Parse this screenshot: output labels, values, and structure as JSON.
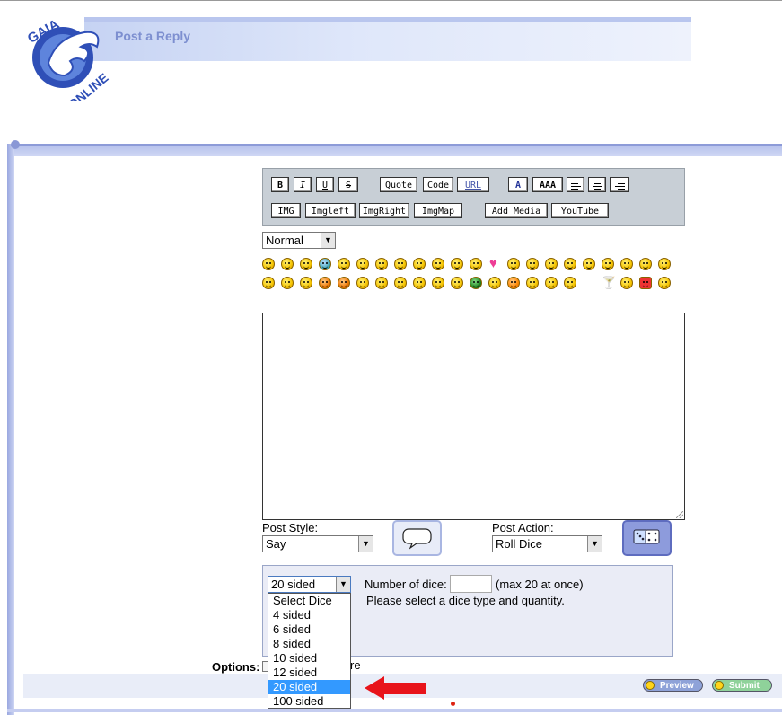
{
  "header": {
    "title": "Post a Reply",
    "logo_top": "GAIA",
    "logo_bottom": "ONLINE"
  },
  "toolbar": {
    "row1": [
      "B",
      "I",
      "U",
      "S",
      "Quote",
      "Code",
      "URL",
      "A",
      "AAA"
    ],
    "row2": [
      "IMG",
      "Imgleft",
      "ImgRight",
      "ImgMap",
      "Add Media",
      "YouTube"
    ]
  },
  "size_select": {
    "value": "Normal"
  },
  "post_style": {
    "label": "Post Style:",
    "value": "Say"
  },
  "post_action": {
    "label": "Post Action:",
    "value": "Roll Dice"
  },
  "dice": {
    "selected": "20 sided",
    "count_label": "Number of dice:",
    "max_note": "(max 20 at once)",
    "hint": "Please select a dice type and quantity.",
    "options": [
      "Select Dice",
      "4 sided",
      "6 sided",
      "8 sided",
      "10 sided",
      "12 sided",
      "20 sided",
      "100 sided"
    ],
    "highlighted_index": 6
  },
  "options": {
    "label": "Options:",
    "partial_text": "re"
  },
  "buttons": {
    "preview": "Preview",
    "submit": "Submit"
  },
  "colors": {
    "accent": "#7d8fd0",
    "highlight": "#3399ff",
    "arrow": "#e8141b"
  }
}
